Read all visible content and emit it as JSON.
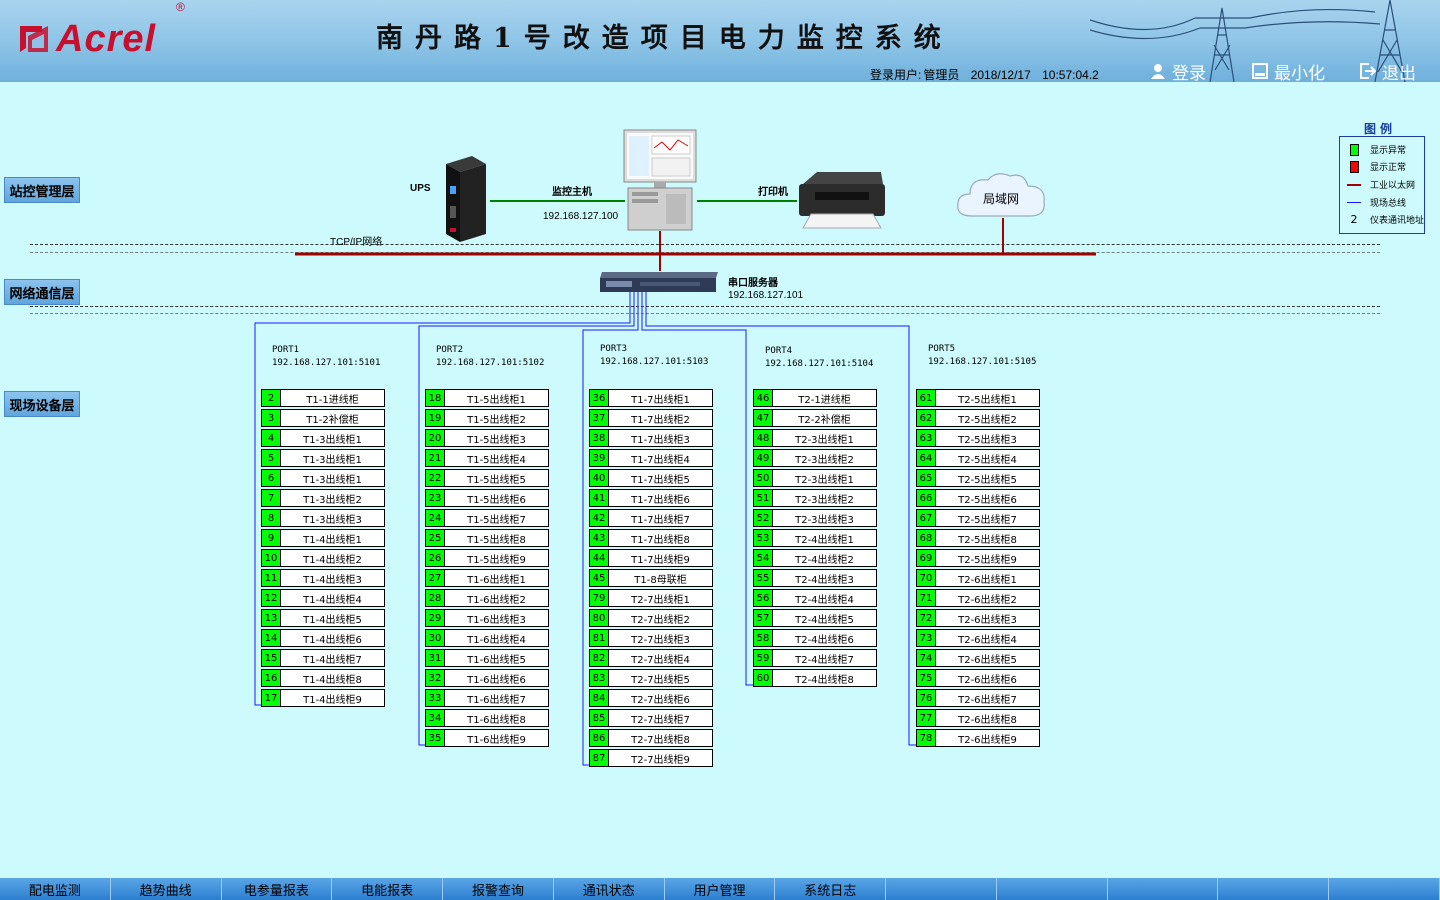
{
  "header": {
    "logo_text": "Acrel",
    "logo_reg": "®",
    "title": "南丹路1号改造项目电力监控系统",
    "login_label": "登录用户:",
    "login_user": "管理员",
    "date": "2018/12/17",
    "time": "10:57:04.2",
    "buttons": {
      "login": "登录",
      "minimize": "最小化",
      "exit": "退出"
    }
  },
  "layers": {
    "station": "站控管理层",
    "network": "网络通信层",
    "field": "现场设备层"
  },
  "topology": {
    "ups": "UPS",
    "host": "监控主机",
    "host_ip": "192.168.127.100",
    "printer": "打印机",
    "lan": "局域网",
    "tcpip": "TCP/IP网络",
    "serial_server": "串口服务器",
    "serial_ip": "192.168.127.101"
  },
  "legend": {
    "title": "图例",
    "items": [
      {
        "label": "显示异常"
      },
      {
        "label": "显示正常"
      },
      {
        "label": "工业以太网"
      },
      {
        "label": "现场总线"
      },
      {
        "symbol": "2",
        "label": "仪表通讯地址"
      }
    ],
    "colors": {
      "abnormal": "#00ff00",
      "normal": "#ff0000",
      "ethernet": "#a00000",
      "fieldbus": "#1a1aff"
    }
  },
  "ports": [
    {
      "name": "PORT1",
      "address": "192.168.127.101:5101",
      "devices": [
        {
          "id": "2",
          "name": "T1-1进线柜"
        },
        {
          "id": "3",
          "name": "T1-2补偿柜"
        },
        {
          "id": "4",
          "name": "T1-3出线柜1"
        },
        {
          "id": "5",
          "name": "T1-3出线柜1"
        },
        {
          "id": "6",
          "name": "T1-3出线柜1"
        },
        {
          "id": "7",
          "name": "T1-3出线柜2"
        },
        {
          "id": "8",
          "name": "T1-3出线柜3"
        },
        {
          "id": "9",
          "name": "T1-4出线柜1"
        },
        {
          "id": "10",
          "name": "T1-4出线柜2"
        },
        {
          "id": "11",
          "name": "T1-4出线柜3"
        },
        {
          "id": "12",
          "name": "T1-4出线柜4"
        },
        {
          "id": "13",
          "name": "T1-4出线柜5"
        },
        {
          "id": "14",
          "name": "T1-4出线柜6"
        },
        {
          "id": "15",
          "name": "T1-4出线柜7"
        },
        {
          "id": "16",
          "name": "T1-4出线柜8"
        },
        {
          "id": "17",
          "name": "T1-4出线柜9"
        }
      ]
    },
    {
      "name": "PORT2",
      "address": "192.168.127.101:5102",
      "devices": [
        {
          "id": "18",
          "name": "T1-5出线柜1"
        },
        {
          "id": "19",
          "name": "T1-5出线柜2"
        },
        {
          "id": "20",
          "name": "T1-5出线柜3"
        },
        {
          "id": "21",
          "name": "T1-5出线柜4"
        },
        {
          "id": "22",
          "name": "T1-5出线柜5"
        },
        {
          "id": "23",
          "name": "T1-5出线柜6"
        },
        {
          "id": "24",
          "name": "T1-5出线柜7"
        },
        {
          "id": "25",
          "name": "T1-5出线柜8"
        },
        {
          "id": "26",
          "name": "T1-5出线柜9"
        },
        {
          "id": "27",
          "name": "T1-6出线柜1"
        },
        {
          "id": "28",
          "name": "T1-6出线柜2"
        },
        {
          "id": "29",
          "name": "T1-6出线柜3"
        },
        {
          "id": "30",
          "name": "T1-6出线柜4"
        },
        {
          "id": "31",
          "name": "T1-6出线柜5"
        },
        {
          "id": "32",
          "name": "T1-6出线柜6"
        },
        {
          "id": "33",
          "name": "T1-6出线柜7"
        },
        {
          "id": "34",
          "name": "T1-6出线柜8"
        },
        {
          "id": "35",
          "name": "T1-6出线柜9"
        }
      ]
    },
    {
      "name": "PORT3",
      "address": "192.168.127.101:5103",
      "devices": [
        {
          "id": "36",
          "name": "T1-7出线柜1"
        },
        {
          "id": "37",
          "name": "T1-7出线柜2"
        },
        {
          "id": "38",
          "name": "T1-7出线柜3"
        },
        {
          "id": "39",
          "name": "T1-7出线柜4"
        },
        {
          "id": "40",
          "name": "T1-7出线柜5"
        },
        {
          "id": "41",
          "name": "T1-7出线柜6"
        },
        {
          "id": "42",
          "name": "T1-7出线柜7"
        },
        {
          "id": "43",
          "name": "T1-7出线柜8"
        },
        {
          "id": "44",
          "name": "T1-7出线柜9"
        },
        {
          "id": "45",
          "name": "T1-8母联柜"
        },
        {
          "id": "79",
          "name": "T2-7出线柜1"
        },
        {
          "id": "80",
          "name": "T2-7出线柜2"
        },
        {
          "id": "81",
          "name": "T2-7出线柜3"
        },
        {
          "id": "82",
          "name": "T2-7出线柜4"
        },
        {
          "id": "83",
          "name": "T2-7出线柜5"
        },
        {
          "id": "84",
          "name": "T2-7出线柜6"
        },
        {
          "id": "85",
          "name": "T2-7出线柜7"
        },
        {
          "id": "86",
          "name": "T2-7出线柜8"
        },
        {
          "id": "87",
          "name": "T2-7出线柜9"
        }
      ]
    },
    {
      "name": "PORT4",
      "address": "192.168.127.101:5104",
      "devices": [
        {
          "id": "46",
          "name": "T2-1进线柜"
        },
        {
          "id": "47",
          "name": "T2-2补偿柜"
        },
        {
          "id": "48",
          "name": "T2-3出线柜1"
        },
        {
          "id": "49",
          "name": "T2-3出线柜2"
        },
        {
          "id": "50",
          "name": "T2-3出线柜1"
        },
        {
          "id": "51",
          "name": "T2-3出线柜2"
        },
        {
          "id": "52",
          "name": "T2-3出线柜3"
        },
        {
          "id": "53",
          "name": "T2-4出线柜1"
        },
        {
          "id": "54",
          "name": "T2-4出线柜2"
        },
        {
          "id": "55",
          "name": "T2-4出线柜3"
        },
        {
          "id": "56",
          "name": "T2-4出线柜4"
        },
        {
          "id": "57",
          "name": "T2-4出线柜5"
        },
        {
          "id": "58",
          "name": "T2-4出线柜6"
        },
        {
          "id": "59",
          "name": "T2-4出线柜7"
        },
        {
          "id": "60",
          "name": "T2-4出线柜8"
        }
      ]
    },
    {
      "name": "PORT5",
      "address": "192.168.127.101:5105",
      "devices": [
        {
          "id": "61",
          "name": "T2-5出线柜1"
        },
        {
          "id": "62",
          "name": "T2-5出线柜2"
        },
        {
          "id": "63",
          "name": "T2-5出线柜3"
        },
        {
          "id": "64",
          "name": "T2-5出线柜4"
        },
        {
          "id": "65",
          "name": "T2-5出线柜5"
        },
        {
          "id": "66",
          "name": "T2-5出线柜6"
        },
        {
          "id": "67",
          "name": "T2-5出线柜7"
        },
        {
          "id": "68",
          "name": "T2-5出线柜8"
        },
        {
          "id": "69",
          "name": "T2-5出线柜9"
        },
        {
          "id": "70",
          "name": "T2-6出线柜1"
        },
        {
          "id": "71",
          "name": "T2-6出线柜2"
        },
        {
          "id": "72",
          "name": "T2-6出线柜3"
        },
        {
          "id": "73",
          "name": "T2-6出线柜4"
        },
        {
          "id": "74",
          "name": "T2-6出线柜5"
        },
        {
          "id": "75",
          "name": "T2-6出线柜6"
        },
        {
          "id": "76",
          "name": "T2-6出线柜7"
        },
        {
          "id": "77",
          "name": "T2-6出线柜8"
        },
        {
          "id": "78",
          "name": "T2-6出线柜9"
        }
      ]
    }
  ],
  "nav": [
    "配电监测",
    "趋势曲线",
    "电参量报表",
    "电能报表",
    "报警查询",
    "通讯状态",
    "用户管理",
    "系统日志",
    "",
    "",
    "",
    "",
    ""
  ]
}
